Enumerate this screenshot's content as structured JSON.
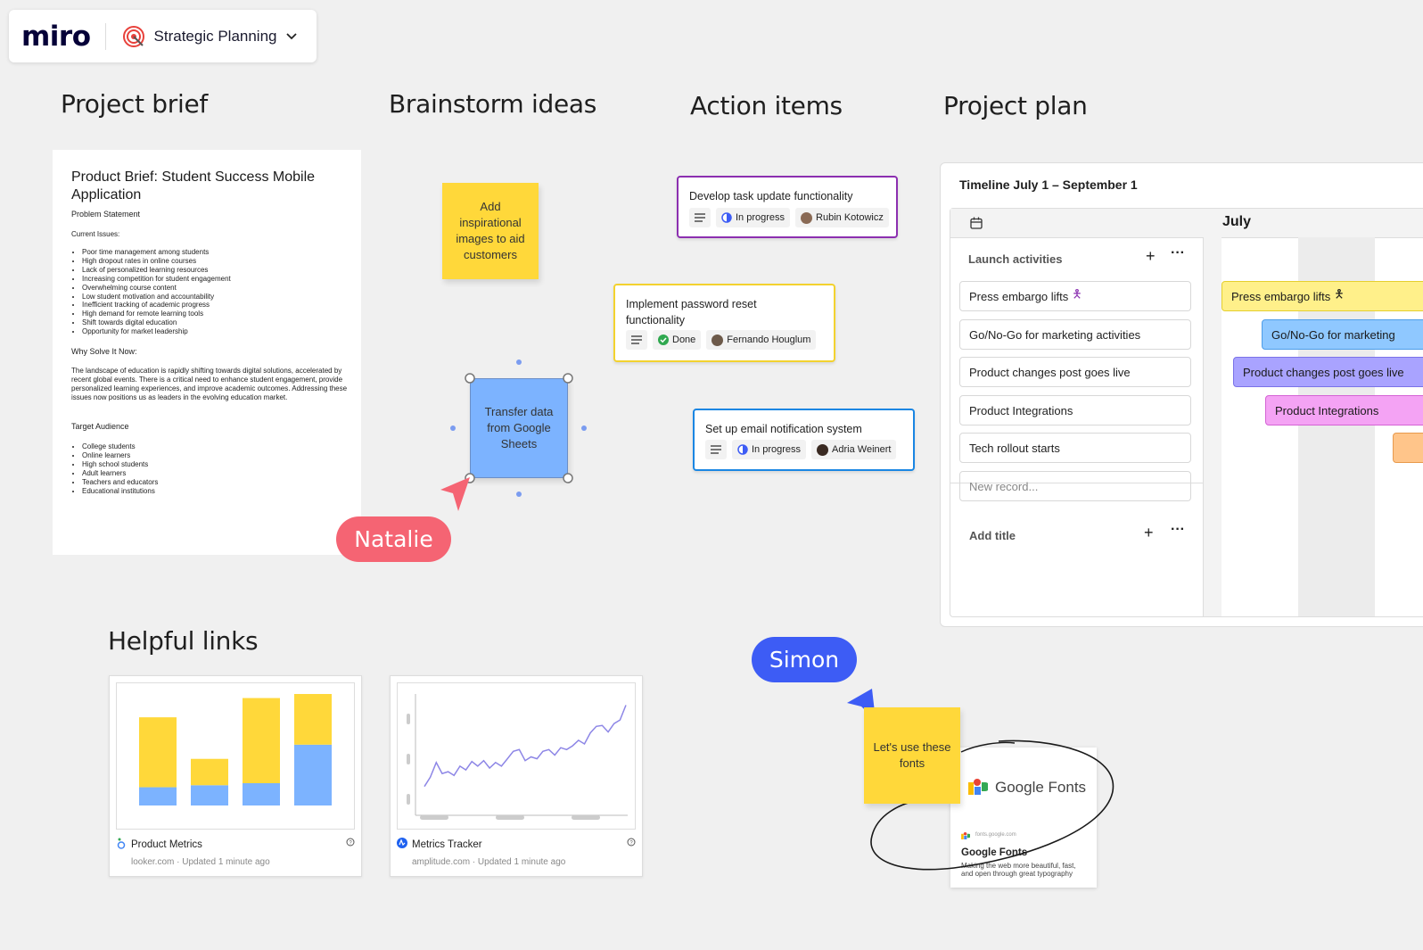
{
  "app": {
    "logo": "miro",
    "board_name": "Strategic Planning"
  },
  "sections": {
    "brief": "Project brief",
    "brainstorm": "Brainstorm ideas",
    "actions": "Action items",
    "plan": "Project plan",
    "links": "Helpful links"
  },
  "brief": {
    "title": "Product Brief: Student Success Mobile Application",
    "problem": "Problem Statement",
    "issues_heading": "Current Issues:",
    "issues": [
      "Poor time management among students",
      "High dropout rates in online courses",
      "Lack of personalized learning resources",
      "Increasing competition for student engagement",
      "Overwhelming course content",
      "Low student motivation and accountability",
      "Inefficient tracking of academic progress",
      "High demand for remote learning tools",
      "Shift towards digital education",
      "Opportunity for market leadership"
    ],
    "why_heading": "Why Solve It Now:",
    "why_text": "The landscape of education is rapidly shifting towards digital solutions, accelerated by recent global events. There is a critical need to enhance student engagement, provide personalized learning experiences, and improve academic outcomes. Addressing these issues now positions us as leaders in the evolving education market.",
    "audience_heading": "Target Audience",
    "audience": [
      "College students",
      "Online learners",
      "High school students",
      "Adult learners",
      "Teachers and educators",
      "Educational institutions"
    ]
  },
  "stickies": {
    "inspire": "Add inspirational images to aid customers",
    "transfer": "Transfer data from Google Sheets",
    "fonts": "Let's use these fonts"
  },
  "actions": [
    {
      "title": "Develop task update functionality",
      "status": "In progress",
      "assignee": "Rubin Kotowicz",
      "color": "#8c2fb0"
    },
    {
      "title": "Implement password reset functionality",
      "status": "Done",
      "assignee": "Fernando Houglum",
      "color": "#f3d22f"
    },
    {
      "title": "Set up email notification system",
      "status": "In progress",
      "assignee": "Adria Weinert",
      "color": "#1a86e3"
    }
  ],
  "plan": {
    "timeline_title": "Timeline July 1 – September 1",
    "month": "July",
    "group_title": "Launch activities",
    "records": [
      "Press embargo lifts",
      "Go/No-Go for marketing activities",
      "Product changes post goes live",
      "Product Integrations",
      "Tech rollout starts"
    ],
    "new_record": "New record...",
    "add_title": "Add title",
    "bars": [
      {
        "label": "Press embargo lifts",
        "color": "#fff08a",
        "border": "#e5cf2e"
      },
      {
        "label": "Go/No-Go for marketing",
        "color": "#8fc8ff",
        "border": "#4d9de8"
      },
      {
        "label": "Product changes post goes live",
        "color": "#a9a3ff",
        "border": "#7a72e8"
      },
      {
        "label": "Product Integrations",
        "color": "#f4a3f4",
        "border": "#d463d4"
      }
    ]
  },
  "cursors": {
    "natalie": {
      "name": "Natalie",
      "color": "#f56473"
    },
    "simon": {
      "name": "Simon",
      "color": "#3d5cf5"
    }
  },
  "links": [
    {
      "name": "Product Metrics",
      "domain": "looker.com",
      "updated": "Updated 1 minute ago"
    },
    {
      "name": "Metrics Tracker",
      "domain": "amplitude.com",
      "updated": "Updated 1 minute ago"
    }
  ],
  "chart_data": [
    {
      "type": "bar",
      "categories": [
        "1",
        "2",
        "3",
        "4"
      ],
      "series": [
        {
          "values": [
            18,
            20,
            22,
            60
          ]
        },
        {
          "values": [
            69,
            26,
            84,
            50
          ]
        }
      ],
      "ylim": [
        0,
        110
      ]
    },
    {
      "type": "line",
      "x": [
        0,
        1,
        2,
        3,
        4,
        5,
        6,
        7,
        8,
        9,
        10,
        11,
        12,
        13,
        14,
        15,
        16,
        17,
        18,
        19,
        20,
        21,
        22,
        23,
        24,
        25,
        26,
        27,
        28,
        29,
        30,
        31,
        32,
        33,
        34
      ],
      "y": [
        8,
        18,
        34,
        22,
        24,
        20,
        30,
        26,
        35,
        30,
        36,
        28,
        34,
        30,
        38,
        46,
        48,
        36,
        40,
        38,
        46,
        48,
        42,
        50,
        48,
        52,
        58,
        54,
        66,
        73,
        74,
        67,
        76,
        80,
        96
      ],
      "ylim": [
        0,
        110
      ]
    }
  ],
  "google_fonts": {
    "brand": "Google Fonts",
    "domain": "fonts.google.com",
    "title": "Google Fonts",
    "desc": "Making the web more beautiful, fast, and open through great typography"
  }
}
